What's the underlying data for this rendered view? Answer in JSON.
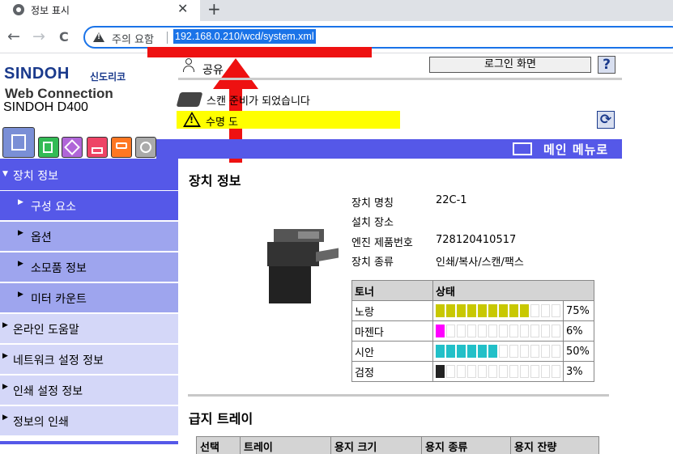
{
  "browser": {
    "tab_title": "정보 표시",
    "tab_close": "✕",
    "new_tab": "+",
    "back": "←",
    "forward": "→",
    "reload": "C",
    "security_label": "주의 요함",
    "url": "192.168.0.210/wcd/system.xml"
  },
  "brand": {
    "logo": "SINDOH",
    "logo_kr": "신도리코",
    "product": "Web Connection",
    "model": "SINDOH D400"
  },
  "header": {
    "user_label": "공유",
    "login_button": "로그인 화면",
    "help_button": "?",
    "status_ready": "스캔 준비가 되었습니다",
    "status_warning": "수명 도",
    "refresh_icon": "refresh-icon"
  },
  "menubar": {
    "main_menu_label": "메인 메뉴로"
  },
  "icon_tabs": [
    "device-info-icon",
    "print-job-icon",
    "box-icon",
    "direct-print-icon",
    "scan-dest-icon",
    "settings-icon"
  ],
  "nav": {
    "device_info": "장치 정보",
    "configuration": "구성 요소",
    "options": "옵션",
    "consumables": "소모품 정보",
    "meter_count": "미터 카운트",
    "online_help": "온라인 도움말",
    "network_settings": "네트워크 설정 정보",
    "print_settings": "인쇄 설정 정보",
    "info_print": "정보의 인쇄"
  },
  "content": {
    "title": "장치 정보",
    "device_name_label": "장치 명칭",
    "device_name": "22C-1",
    "location_label": "설치 장소",
    "location": "",
    "serial_label": "엔진 제품번호",
    "serial": "728120410517",
    "type_label": "장치 종류",
    "type": "인쇄/복사/스캔/팩스"
  },
  "toner": {
    "header_toner": "토너",
    "header_status": "상태",
    "rows": [
      {
        "name": "노랑",
        "percent": "75%",
        "level": 0.75,
        "color": "#c8c800"
      },
      {
        "name": "마젠다",
        "percent": "6%",
        "level": 0.06,
        "color": "#ff00ff"
      },
      {
        "name": "시안",
        "percent": "50%",
        "level": 0.5,
        "color": "#22c0c8"
      },
      {
        "name": "검정",
        "percent": "3%",
        "level": 0.03,
        "color": "#222222"
      }
    ]
  },
  "tray": {
    "title": "급지 트레이",
    "columns": [
      "선택",
      "트레이",
      "용지 크기",
      "용지 종류",
      "용지 잔량"
    ]
  }
}
